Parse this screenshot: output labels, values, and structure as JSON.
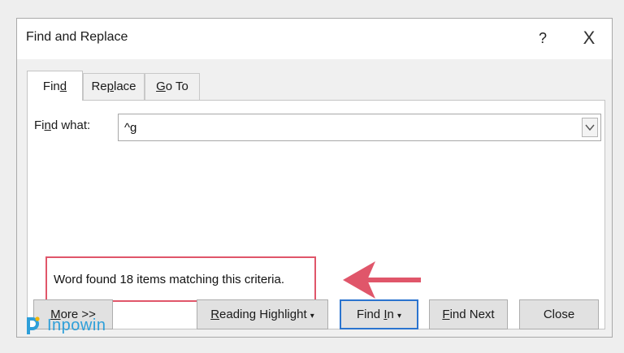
{
  "window": {
    "title": "Find and Replace",
    "help": "?",
    "close": "X"
  },
  "tabs": [
    {
      "pre": "Fin",
      "key": "d",
      "post": ""
    },
    {
      "pre": "Re",
      "key": "p",
      "post": "lace"
    },
    {
      "pre": "",
      "key": "G",
      "post": "o To"
    }
  ],
  "find_what": {
    "pre": "Fi",
    "key": "n",
    "post": "d what:",
    "value": "^g"
  },
  "message": "Word found 18 items matching this criteria.",
  "buttons": {
    "more": {
      "key": "M",
      "post": "ore >>"
    },
    "reading_highlight": {
      "key": "R",
      "post": "eading Highlight",
      "caret": "▾"
    },
    "find_in": {
      "key": "I",
      "pre": "Find ",
      "post": "n",
      "caret": "▾"
    },
    "find_next": {
      "key": "F",
      "post": "ind Next"
    },
    "close": {
      "label": "Close"
    }
  },
  "watermark": {
    "text": "Inpowin"
  },
  "colors": {
    "accent_blue": "#2b74cf",
    "annotation": "#e0566a",
    "logo": "#2e9fd9"
  }
}
